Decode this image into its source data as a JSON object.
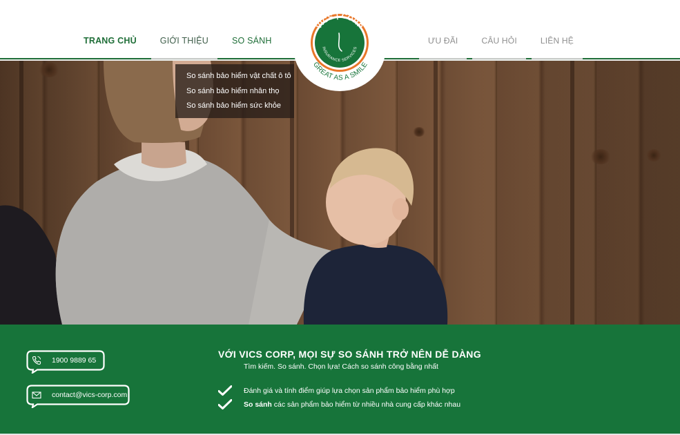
{
  "nav": {
    "left": [
      {
        "label": "TRANG CHỦ"
      },
      {
        "label": "GIỚI THIỆU"
      },
      {
        "label": "SO SÁNH"
      }
    ],
    "right": [
      {
        "label": "ƯU ĐÃI"
      },
      {
        "label": "CÂU HỎI"
      },
      {
        "label": "LIÊN HỆ"
      }
    ]
  },
  "logo": {
    "top_text": "VICS | CORP",
    "ring_text": "INSURANCE SERVICES",
    "tagline": "GREAT AS A SMILE"
  },
  "dropdown": {
    "items": [
      {
        "label": "So sánh bảo hiểm vật chất ô tô"
      },
      {
        "label": "So sánh bảo hiểm nhân thọ"
      },
      {
        "label": "So sánh bảo hiểm sức khỏe"
      }
    ]
  },
  "contact": {
    "phone": "1900 9889 65",
    "email": "contact@vics-corp.com"
  },
  "band": {
    "title": "VỚI VICS CORP, MỌI SỰ SO SÁNH TRỞ NÊN DỄ DÀNG",
    "subtitle": "Tìm kiếm. So sánh. Chọn lựa! Cách so sánh công bằng nhất",
    "bullets": [
      {
        "bold": "",
        "text": "Đánh giá và tính điểm giúp lựa chọn sản phẩm bảo hiểm phù hợp"
      },
      {
        "bold": "So sánh",
        "text": " các sản phẩm bảo hiểm từ nhiều nhà cung cấp khác nhau"
      }
    ]
  },
  "colors": {
    "brand_green": "#17743a",
    "nav_green": "#1f6e38",
    "logo_orange": "#e8772a"
  },
  "icons": {
    "phone": "phone-icon",
    "email": "envelope-icon",
    "check": "checkmark-icon"
  }
}
